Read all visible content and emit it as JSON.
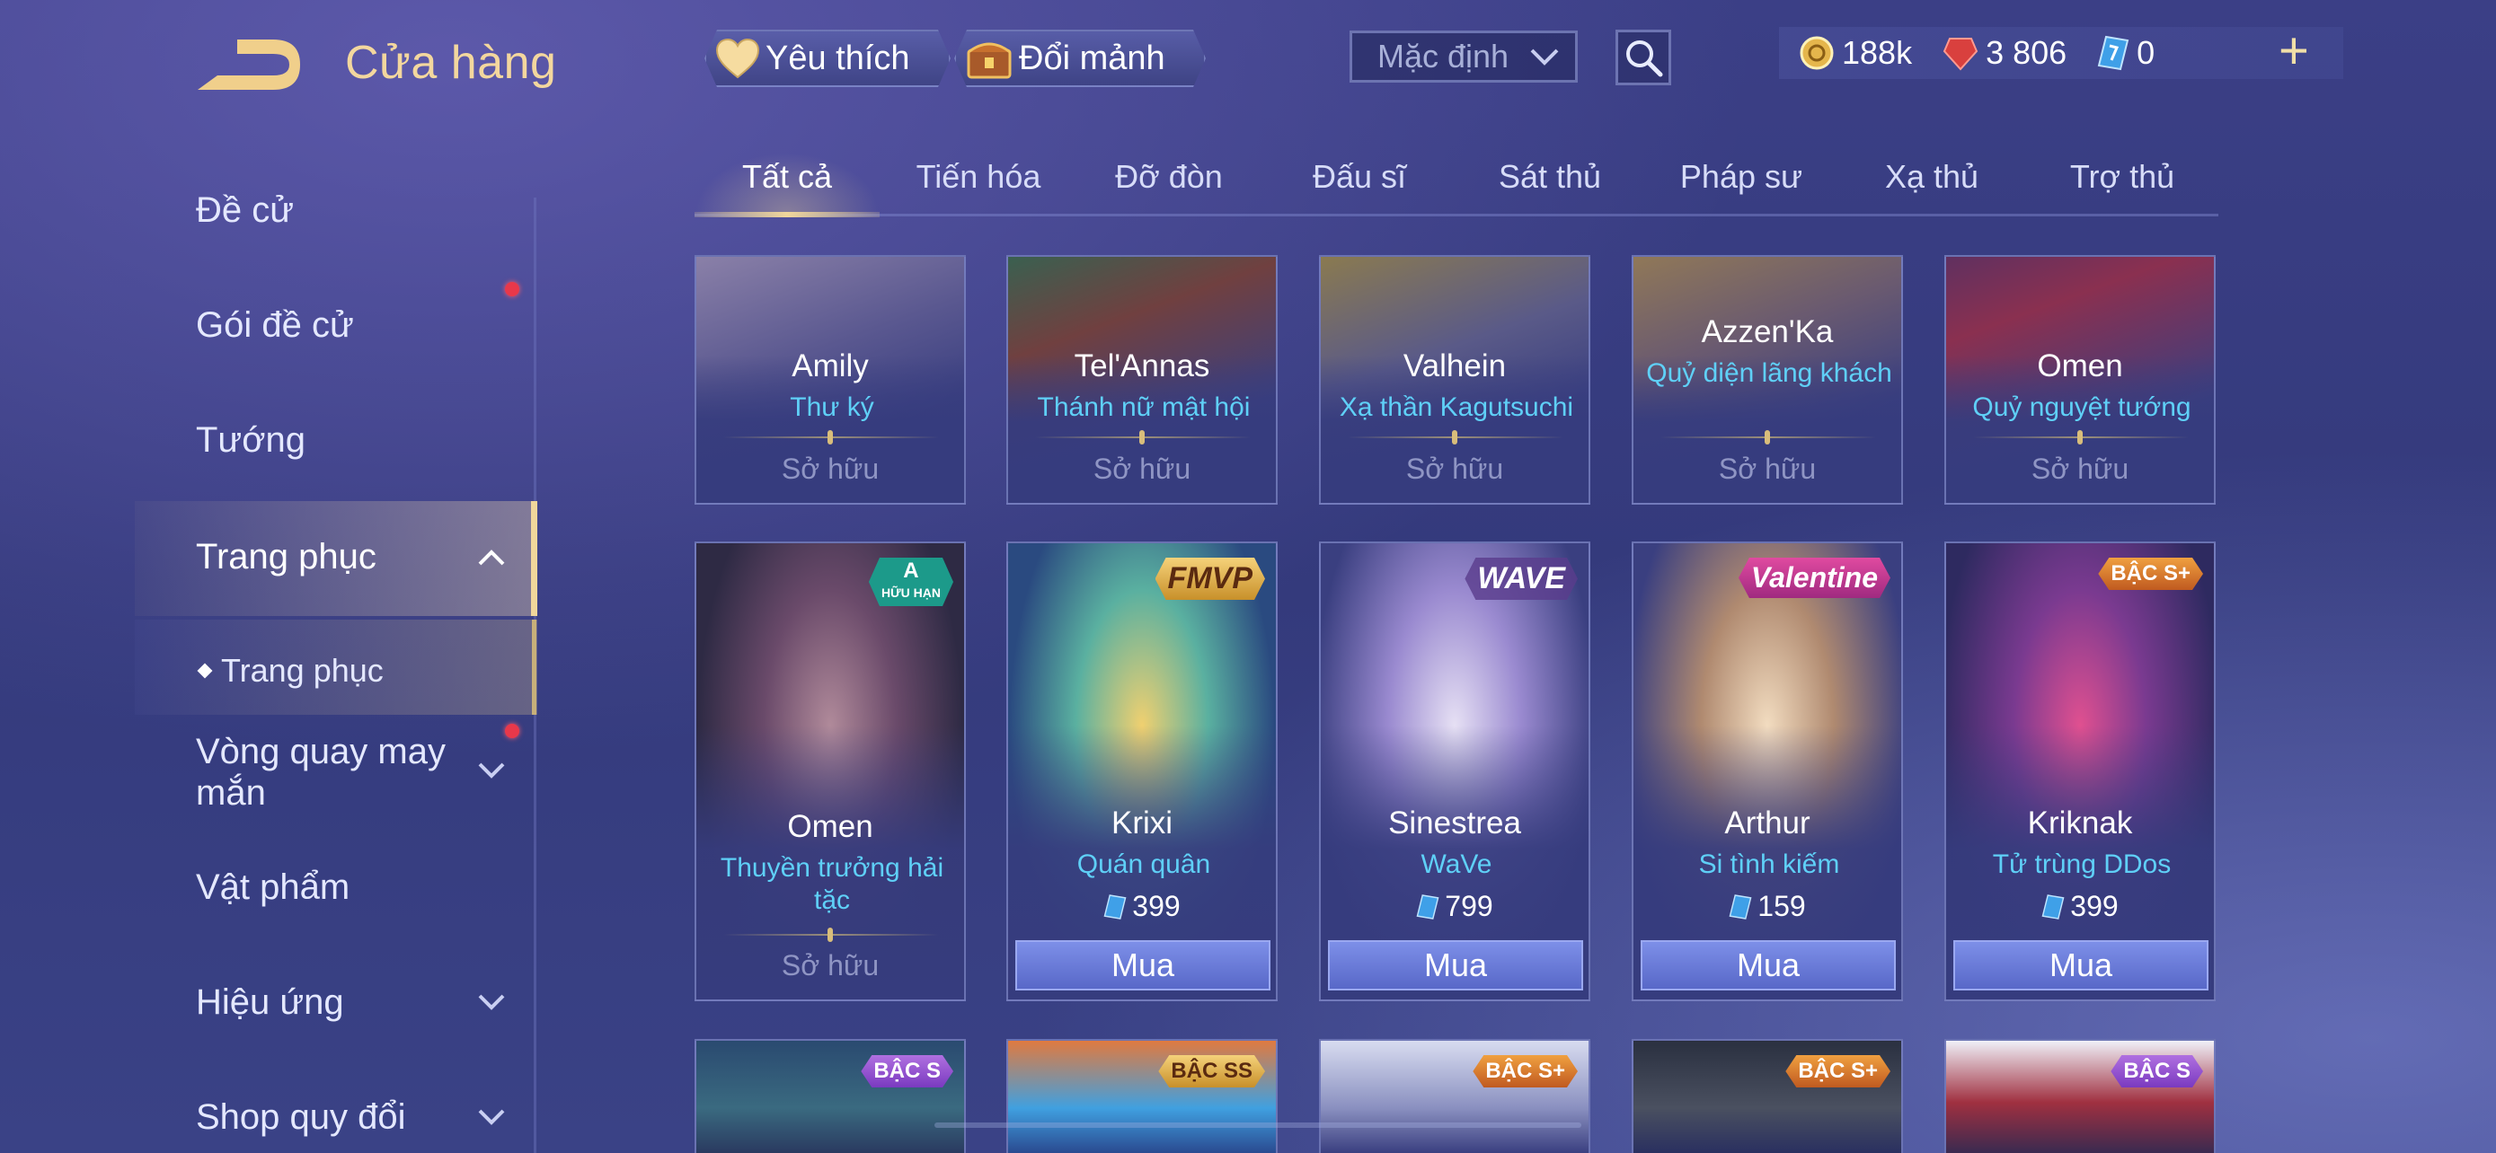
{
  "header": {
    "title": "Cửa hàng",
    "favorite_label": "Yêu thích",
    "exchange_label": "Đổi mảnh",
    "sort": {
      "selected": "Mặc định"
    },
    "currencies": [
      {
        "icon": "gold-coin-icon",
        "value": "188k"
      },
      {
        "icon": "ruby-gem-icon",
        "value": "3 806"
      },
      {
        "icon": "voucher-icon",
        "value": "0"
      }
    ],
    "add_label": "+"
  },
  "sidebar": {
    "items": [
      {
        "label": "Đề cử"
      },
      {
        "label": "Gói đề cử"
      },
      {
        "label": "Tướng"
      },
      {
        "label": "Trang phục"
      },
      {
        "label": "Trang phục"
      },
      {
        "label": "Vòng quay may mắn"
      },
      {
        "label": "Vật phẩm"
      },
      {
        "label": "Hiệu ứng"
      },
      {
        "label": "Shop quy đổi"
      }
    ]
  },
  "tabs": [
    {
      "label": "Tất cả"
    },
    {
      "label": "Tiến hóa"
    },
    {
      "label": "Đỡ đòn"
    },
    {
      "label": "Đấu sĩ"
    },
    {
      "label": "Sát thủ"
    },
    {
      "label": "Pháp sư"
    },
    {
      "label": "Xạ thủ"
    },
    {
      "label": "Trợ thủ"
    }
  ],
  "cards_row1": [
    {
      "hero": "Amily",
      "skin": "Thư ký",
      "status": "Sở hữu"
    },
    {
      "hero": "Tel'Annas",
      "skin": "Thánh nữ mật hội",
      "status": "Sở hữu"
    },
    {
      "hero": "Valhein",
      "skin": "Xạ thần Kagutsuchi",
      "status": "Sở hữu"
    },
    {
      "hero": "Azzen'Ka",
      "skin": "Quỷ diện lãng khách",
      "status": "Sở hữu"
    },
    {
      "hero": "Omen",
      "skin": "Quỷ nguyệt tướng",
      "status": "Sở hữu"
    }
  ],
  "cards_row2": [
    {
      "hero": "Omen",
      "skin": "Thuyền trưởng hải tặc",
      "status": "Sở hữu",
      "badge": "A",
      "badge_sub": "HỮU HẠN"
    },
    {
      "hero": "Krixi",
      "skin": "Quán quân",
      "price": "399",
      "buy": "Mua",
      "badge": "FMVP"
    },
    {
      "hero": "Sinestrea",
      "skin": "WaVe",
      "price": "799",
      "buy": "Mua",
      "badge": "WAVE"
    },
    {
      "hero": "Arthur",
      "skin": "Si tình kiếm",
      "price": "159",
      "buy": "Mua",
      "badge": "Valentine"
    },
    {
      "hero": "Kriknak",
      "skin": "Tử trùng DDos",
      "price": "399",
      "buy": "Mua",
      "badge": "BẬC S+"
    }
  ],
  "cards_row3_badges": [
    "BẬC S",
    "BẬC SS",
    "BẬC S+",
    "BẬC S+",
    "BẬC S"
  ],
  "colors": {
    "accent_gold": "#f1d79b",
    "skin_name": "#5fd0f7",
    "buy_button": "#6a7ad8",
    "notification": "#e8384a"
  }
}
